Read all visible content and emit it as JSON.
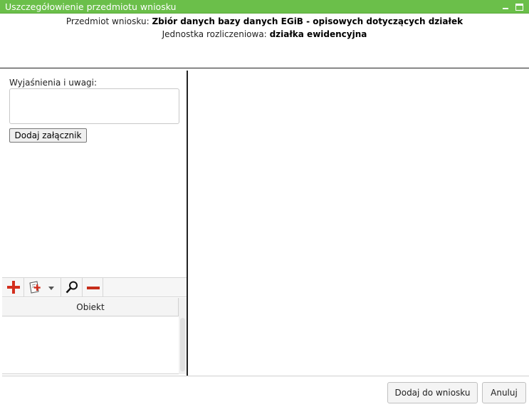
{
  "window": {
    "title": "Uszczegółowienie przedmiotu wniosku"
  },
  "header": {
    "subject_label": "Przedmiot wniosku:",
    "subject_value": "Zbiór danych bazy danych EGiB - opisowych dotyczących działek",
    "unit_label": "Jednostka rozliczeniowa:",
    "unit_value": "działka ewidencyjna"
  },
  "left_panel": {
    "remarks_label": "Wyjaśnienia i uwagi:",
    "remarks_value": "",
    "attach_button_label": "Dodaj załącznik",
    "toolbar": {
      "icons": [
        "plus-icon",
        "document-add-icon",
        "dropdown-arrow-icon",
        "magnifier-icon",
        "minus-icon"
      ],
      "colors": {
        "add": "#d32f1e",
        "remove": "#c62d1b"
      }
    },
    "grid": {
      "columns": [
        "Obiekt"
      ],
      "rows": []
    }
  },
  "footer": {
    "add_button_label": "Dodaj do wniosku",
    "cancel_button_label": "Anuluj"
  },
  "colors": {
    "titlebar": "#6bbf4a",
    "divider": "#222222"
  }
}
